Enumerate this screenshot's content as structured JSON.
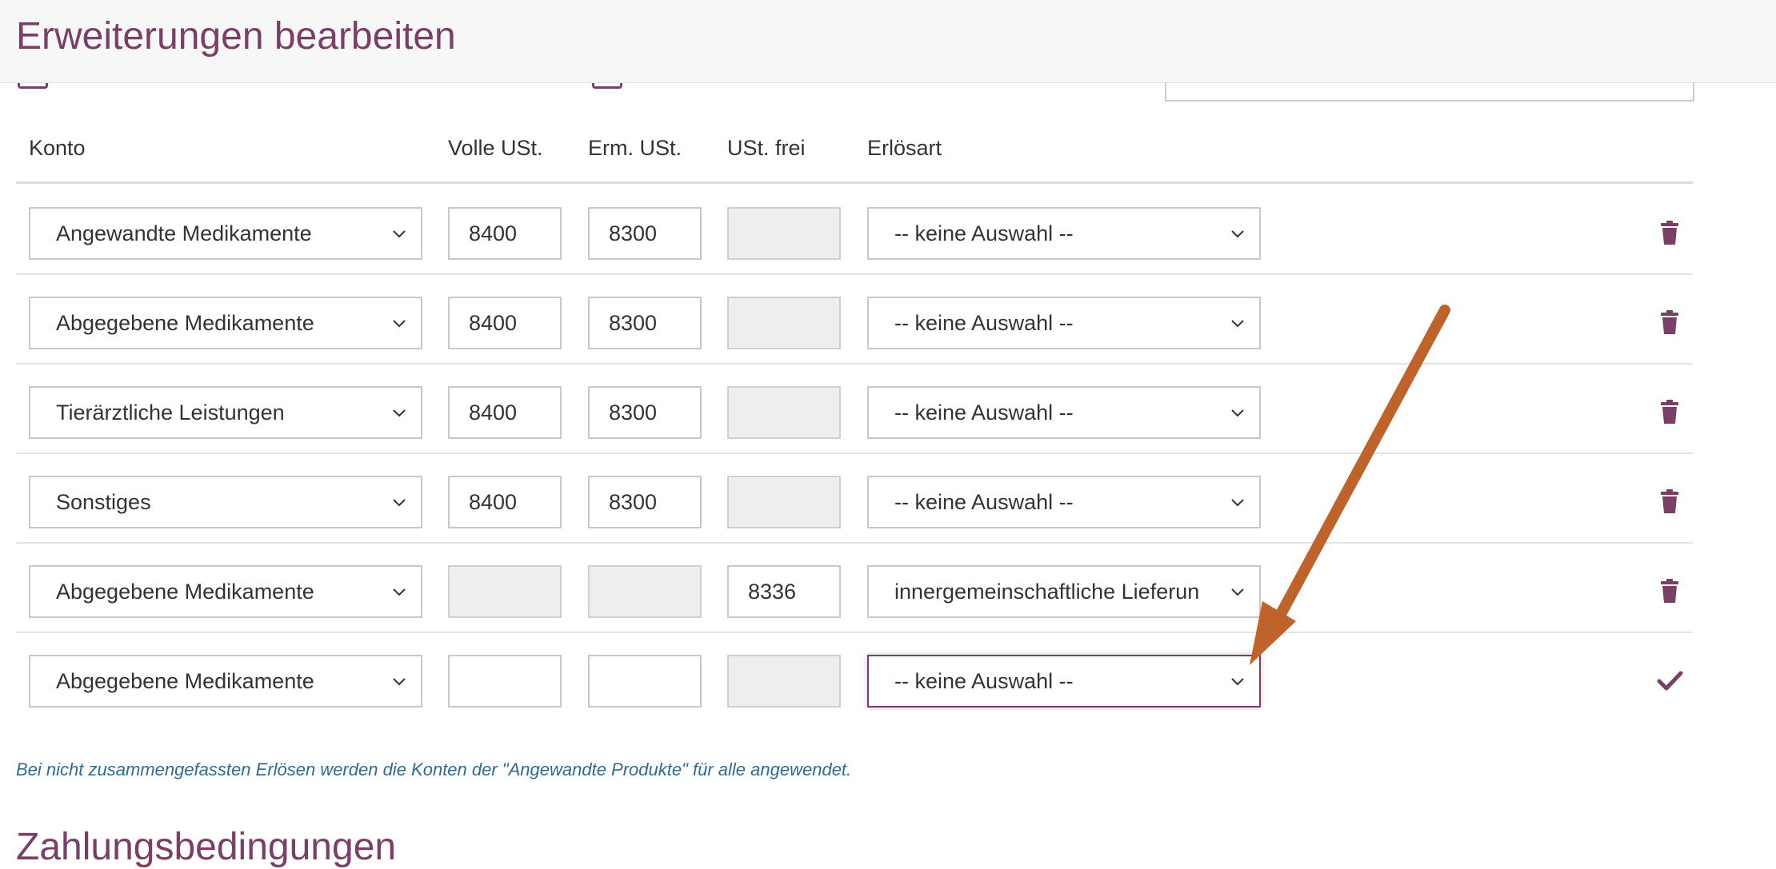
{
  "header": {
    "title": "Erweiterungen bearbeiten"
  },
  "columns": {
    "konto": "Konto",
    "volle": "Volle USt.",
    "erm": "Erm. USt.",
    "frei": "USt. frei",
    "erloesart": "Erlösart"
  },
  "rows": [
    {
      "konto": "Angewandte Medikamente",
      "volle": "8400",
      "erm": "8300",
      "frei": "",
      "erloesart": "-- keine Auswahl --",
      "action": "trash-icon"
    },
    {
      "konto": "Abgegebene Medikamente",
      "volle": "8400",
      "erm": "8300",
      "frei": "",
      "erloesart": "-- keine Auswahl --",
      "action": "trash-icon"
    },
    {
      "konto": "Tierärztliche Leistungen",
      "volle": "8400",
      "erm": "8300",
      "frei": "",
      "erloesart": "-- keine Auswahl --",
      "action": "trash-icon"
    },
    {
      "konto": "Sonstiges",
      "volle": "8400",
      "erm": "8300",
      "frei": "",
      "erloesart": "-- keine Auswahl --",
      "action": "trash-icon"
    },
    {
      "konto": "Abgegebene Medikamente",
      "volle": "",
      "erm": "",
      "frei": "8336",
      "erloesart": "innergemeinschaftliche Lieferun",
      "action": "trash-icon"
    },
    {
      "konto": "Abgegebene Medikamente",
      "volle": "",
      "erm": "",
      "frei": "",
      "erloesart": "-- keine Auswahl --",
      "action": "checkmark-icon"
    }
  ],
  "note": "Bei nicht zusammengefassten Erlösen werden die Konten der \"Angewandte Produkte\" für alle angewendet.",
  "next_section_title": "Zahlungsbedingungen",
  "colors": {
    "accent": "#7a3e67",
    "note": "#2e6b90",
    "arrow": "#c0632a"
  }
}
